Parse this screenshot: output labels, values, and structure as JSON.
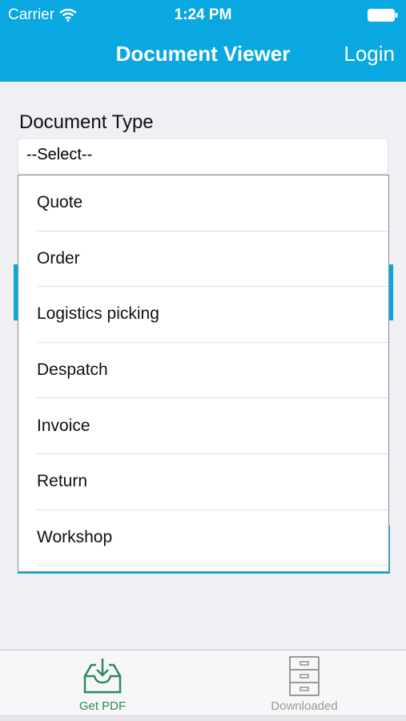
{
  "status_bar": {
    "carrier": "Carrier",
    "time": "1:24 PM",
    "wifi_icon": "wifi-icon",
    "battery_icon": "battery-icon"
  },
  "nav": {
    "title": "Document Viewer",
    "login_label": "Login"
  },
  "form": {
    "document_type_label": "Document Type",
    "select_value": "--Select--",
    "options": [
      "Quote",
      "Order",
      "Logistics picking",
      "Despatch",
      "Invoice",
      "Return",
      "Workshop"
    ]
  },
  "tabbar": {
    "tabs": [
      {
        "label": "Get PDF",
        "icon": "inbox-download-icon",
        "active": true
      },
      {
        "label": "Downloaded",
        "icon": "file-cabinet-icon",
        "active": false
      }
    ]
  },
  "colors": {
    "accent": "#0aa8e0",
    "active_tab": "#2e8b57",
    "inactive_tab": "#9a9a9a"
  }
}
